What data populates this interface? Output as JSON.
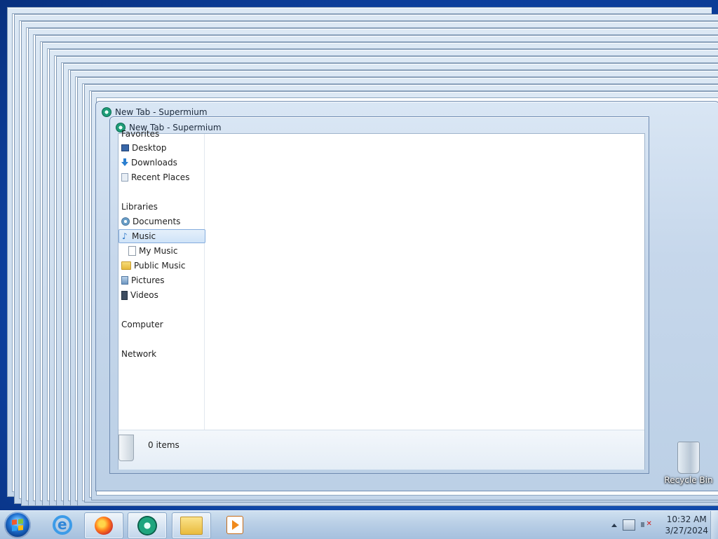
{
  "windows": {
    "back_title": "New Tab - Supermium",
    "front_title": "New Tab - Supermium"
  },
  "explorer": {
    "nav": {
      "favorites_header": "Favorites",
      "favorites": [
        "Desktop",
        "Downloads",
        "Recent Places"
      ],
      "libraries_header": "Libraries",
      "libraries": [
        "Documents",
        "Music",
        "My Music",
        "Public Music",
        "Pictures",
        "Videos"
      ],
      "selected": "Music",
      "computer": "Computer",
      "network": "Network"
    },
    "status": {
      "count": "0 items"
    }
  },
  "desktop": {
    "recycle_bin": "Recycle Bin"
  },
  "taskbar": {
    "pinned": [
      "start-button",
      "internet-explorer",
      "firefox",
      "supermium",
      "windows-explorer",
      "media-player"
    ],
    "clock": {
      "time": "10:32 AM",
      "date": "3/27/2024"
    }
  },
  "colors": {
    "selection": "#cfe3f8",
    "taskbar": "#b9cfe6",
    "desktop": "#1a5fc4"
  }
}
